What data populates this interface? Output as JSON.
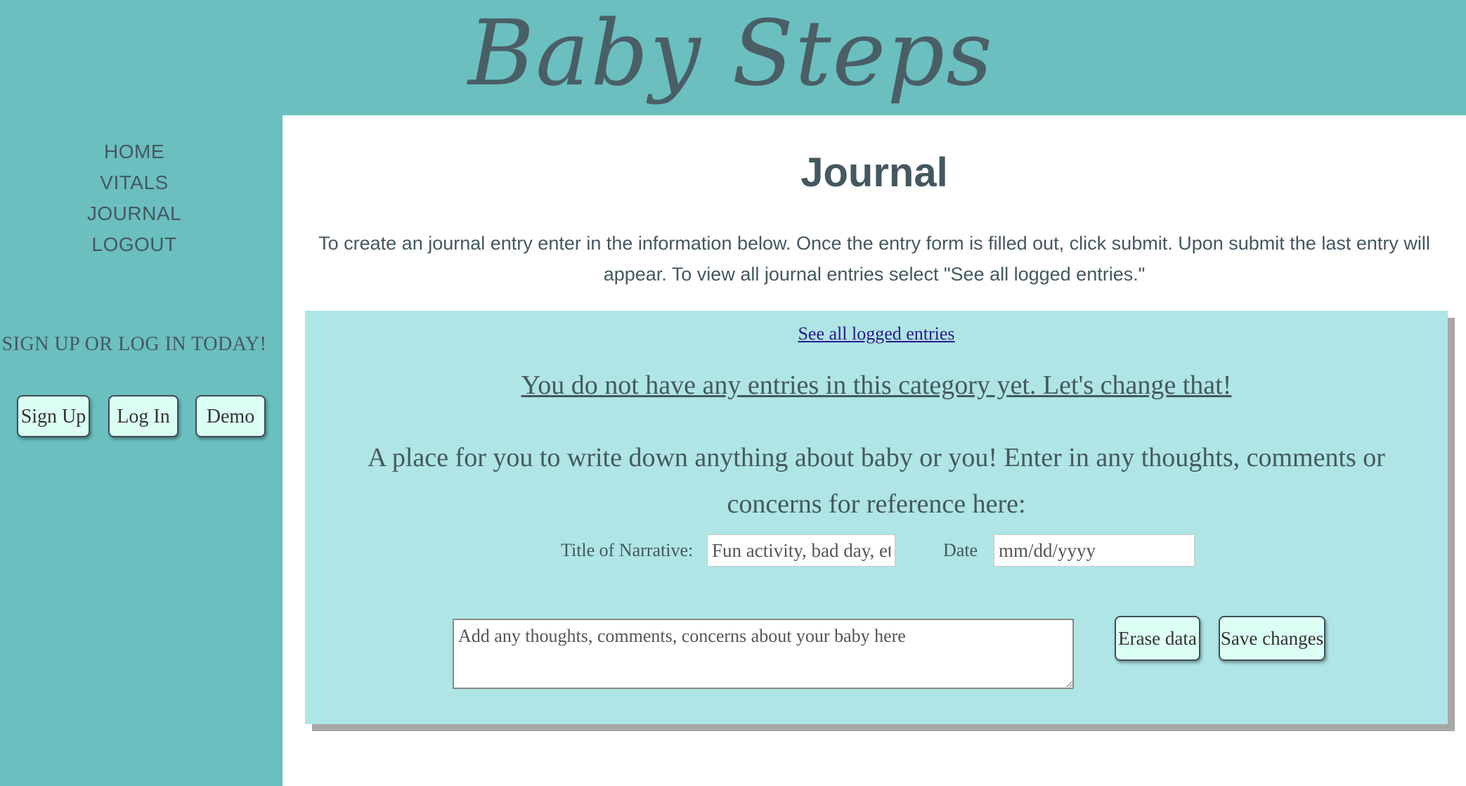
{
  "header": {
    "logo_text": "Baby Steps"
  },
  "sidebar": {
    "nav": [
      {
        "label": "HOME"
      },
      {
        "label": "VITALS"
      },
      {
        "label": "JOURNAL"
      },
      {
        "label": "LOGOUT"
      }
    ],
    "signup_prompt": "SIGN UP OR LOG IN TODAY!",
    "buttons": {
      "sign_up": "Sign Up",
      "log_in": "Log In",
      "demo": "Demo"
    }
  },
  "main": {
    "title": "Journal",
    "intro": "To create an journal entry enter in the information below. Once the entry form is filled out, click submit. Upon submit the last entry will appear. To view all journal entries select \"See all logged entries.\"",
    "panel": {
      "see_all_link": "See all logged entries",
      "no_entries": "You do not have any entries in this category yet. Let's change that!",
      "description": "A place for you to write down anything about baby or you! Enter in any thoughts, comments or concerns for reference here:",
      "title_label": "Title of Narrative:",
      "title_placeholder": "Fun activity, bad day, etc",
      "date_label": "Date",
      "date_placeholder": "mm/dd/yyyy",
      "textarea_placeholder": "Add any thoughts, comments, concerns about your baby here",
      "erase_button": "Erase data",
      "save_button": "Save changes"
    }
  },
  "colors": {
    "background": "#6bbfbf",
    "panel": "#afe5e5",
    "text": "#44585f",
    "button_bg": "#dcfff3",
    "link": "#2a1a8c"
  }
}
